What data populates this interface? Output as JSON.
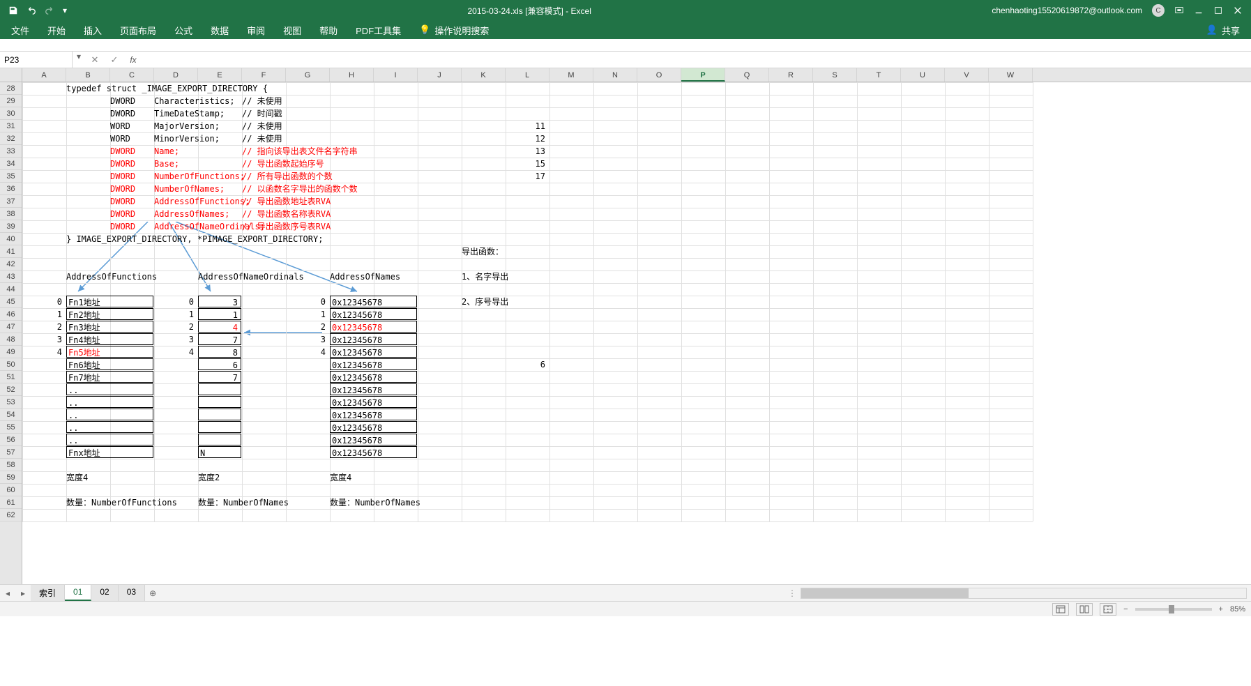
{
  "title_bar": {
    "doc_title": "2015-03-24.xls [兼容模式] - Excel",
    "user_email": "chenhaoting15520619872@outlook.com",
    "avatar_letter": "C"
  },
  "ribbon": {
    "tabs": [
      "文件",
      "开始",
      "插入",
      "页面布局",
      "公式",
      "数据",
      "审阅",
      "视图",
      "帮助",
      "PDF工具集"
    ],
    "tell_me": "操作说明搜索",
    "share": "共享"
  },
  "formula_bar": {
    "cell_ref": "P23",
    "fx_label": "fx",
    "formula_value": ""
  },
  "grid": {
    "columns": [
      "A",
      "B",
      "C",
      "D",
      "E",
      "F",
      "G",
      "H",
      "I",
      "J",
      "K",
      "L",
      "M",
      "N",
      "O",
      "P",
      "Q",
      "R",
      "S",
      "T",
      "U",
      "V",
      "W"
    ],
    "selected_column_index": 15,
    "row_start": 28,
    "row_end": 62,
    "rows": [
      {
        "r": 28,
        "cells": [
          {
            "c": 1,
            "t": "typedef struct _IMAGE_EXPORT_DIRECTORY {"
          }
        ]
      },
      {
        "r": 29,
        "cells": [
          {
            "c": 2,
            "t": "DWORD"
          },
          {
            "c": 3,
            "t": "Characteristics;"
          },
          {
            "c": 5,
            "t": "// 未使用"
          }
        ]
      },
      {
        "r": 30,
        "cells": [
          {
            "c": 2,
            "t": "DWORD"
          },
          {
            "c": 3,
            "t": "TimeDateStamp;"
          },
          {
            "c": 5,
            "t": "// 时间戳"
          }
        ]
      },
      {
        "r": 31,
        "cells": [
          {
            "c": 2,
            "t": "WORD"
          },
          {
            "c": 3,
            "t": "MajorVersion;"
          },
          {
            "c": 5,
            "t": "// 未使用"
          },
          {
            "c": 11,
            "t": "11",
            "ra": 1
          }
        ]
      },
      {
        "r": 32,
        "cells": [
          {
            "c": 2,
            "t": "WORD"
          },
          {
            "c": 3,
            "t": "MinorVersion;"
          },
          {
            "c": 5,
            "t": "// 未使用"
          },
          {
            "c": 11,
            "t": "12",
            "ra": 1
          }
        ]
      },
      {
        "r": 33,
        "cells": [
          {
            "c": 2,
            "t": "DWORD",
            "red": 1
          },
          {
            "c": 3,
            "t": "Name;",
            "red": 1
          },
          {
            "c": 5,
            "t": "// 指向该导出表文件名字符串",
            "red": 1
          },
          {
            "c": 11,
            "t": "13",
            "ra": 1
          }
        ]
      },
      {
        "r": 34,
        "cells": [
          {
            "c": 2,
            "t": "DWORD",
            "red": 1
          },
          {
            "c": 3,
            "t": "Base;",
            "red": 1
          },
          {
            "c": 5,
            "t": "// 导出函数起始序号",
            "red": 1
          },
          {
            "c": 11,
            "t": "15",
            "ra": 1
          }
        ]
      },
      {
        "r": 35,
        "cells": [
          {
            "c": 2,
            "t": "DWORD",
            "red": 1
          },
          {
            "c": 3,
            "t": "NumberOfFunctions;",
            "red": 1
          },
          {
            "c": 5,
            "t": "// 所有导出函数的个数",
            "red": 1
          },
          {
            "c": 11,
            "t": "17",
            "ra": 1
          }
        ]
      },
      {
        "r": 36,
        "cells": [
          {
            "c": 2,
            "t": "DWORD",
            "red": 1
          },
          {
            "c": 3,
            "t": "NumberOfNames;",
            "red": 1
          },
          {
            "c": 5,
            "t": "// 以函数名字导出的函数个数",
            "red": 1
          }
        ]
      },
      {
        "r": 37,
        "cells": [
          {
            "c": 2,
            "t": "DWORD",
            "red": 1
          },
          {
            "c": 3,
            "t": "AddressOfFunctions;",
            "red": 1
          },
          {
            "c": 5,
            "t": "   // 导出函数地址表RVA",
            "red": 1
          }
        ]
      },
      {
        "r": 38,
        "cells": [
          {
            "c": 2,
            "t": "DWORD",
            "red": 1
          },
          {
            "c": 3,
            "t": "AddressOfNames;",
            "red": 1
          },
          {
            "c": 5,
            "t": "   // 导出函数名称表RVA",
            "red": 1
          }
        ]
      },
      {
        "r": 39,
        "cells": [
          {
            "c": 2,
            "t": "DWORD",
            "red": 1
          },
          {
            "c": 3,
            "t": "AddressOfNameOrdinals;",
            "red": 1
          },
          {
            "c": 5,
            "t": "// 导出函数序号表RVA",
            "red": 1
          }
        ]
      },
      {
        "r": 40,
        "cells": [
          {
            "c": 1,
            "t": "} IMAGE_EXPORT_DIRECTORY, *PIMAGE_EXPORT_DIRECTORY;"
          }
        ]
      },
      {
        "r": 41,
        "cells": [
          {
            "c": 10,
            "t": "导出函数："
          }
        ]
      },
      {
        "r": 43,
        "cells": [
          {
            "c": 1,
            "t": "AddressOfFunctions"
          },
          {
            "c": 4,
            "t": "AddressOfNameOrdinals"
          },
          {
            "c": 7,
            "t": "AddressOfNames"
          },
          {
            "c": 10,
            "t": "1、名字导出"
          }
        ]
      },
      {
        "r": 45,
        "cells": [
          {
            "c": 0,
            "t": "0",
            "ra": 1
          },
          {
            "c": 1,
            "t": "Fn1地址",
            "box": 1,
            "w": 2
          },
          {
            "c": 3,
            "t": "0",
            "ra": 1
          },
          {
            "c": 4,
            "t": "3",
            "ra": 1,
            "box": 1
          },
          {
            "c": 6,
            "t": "0",
            "ra": 1
          },
          {
            "c": 7,
            "t": "0x12345678",
            "box": 1,
            "w": 2
          },
          {
            "c": 10,
            "t": "2、序号导出"
          }
        ]
      },
      {
        "r": 46,
        "cells": [
          {
            "c": 0,
            "t": "1",
            "ra": 1
          },
          {
            "c": 1,
            "t": "Fn2地址",
            "box": 1,
            "w": 2
          },
          {
            "c": 3,
            "t": "1",
            "ra": 1
          },
          {
            "c": 4,
            "t": "1",
            "ra": 1,
            "box": 1
          },
          {
            "c": 6,
            "t": "1",
            "ra": 1
          },
          {
            "c": 7,
            "t": "0x12345678",
            "box": 1,
            "w": 2
          }
        ]
      },
      {
        "r": 47,
        "cells": [
          {
            "c": 0,
            "t": "2",
            "ra": 1
          },
          {
            "c": 1,
            "t": "Fn3地址",
            "box": 1,
            "w": 2
          },
          {
            "c": 3,
            "t": "2",
            "ra": 1
          },
          {
            "c": 4,
            "t": "4",
            "ra": 1,
            "box": 1,
            "red": 1
          },
          {
            "c": 6,
            "t": "2",
            "ra": 1
          },
          {
            "c": 7,
            "t": "0x12345678",
            "box": 1,
            "w": 2,
            "red": 1
          }
        ]
      },
      {
        "r": 48,
        "cells": [
          {
            "c": 0,
            "t": "3",
            "ra": 1
          },
          {
            "c": 1,
            "t": "Fn4地址",
            "box": 1,
            "w": 2
          },
          {
            "c": 3,
            "t": "3",
            "ra": 1
          },
          {
            "c": 4,
            "t": "7",
            "ra": 1,
            "box": 1
          },
          {
            "c": 6,
            "t": "3",
            "ra": 1
          },
          {
            "c": 7,
            "t": "0x12345678",
            "box": 1,
            "w": 2
          }
        ]
      },
      {
        "r": 49,
        "cells": [
          {
            "c": 0,
            "t": "4",
            "ra": 1
          },
          {
            "c": 1,
            "t": "Fn5地址",
            "box": 1,
            "w": 2,
            "red": 1
          },
          {
            "c": 3,
            "t": "4",
            "ra": 1
          },
          {
            "c": 4,
            "t": "8",
            "ra": 1,
            "box": 1
          },
          {
            "c": 6,
            "t": "4",
            "ra": 1
          },
          {
            "c": 7,
            "t": "0x12345678",
            "box": 1,
            "w": 2
          }
        ]
      },
      {
        "r": 50,
        "cells": [
          {
            "c": 1,
            "t": "Fn6地址",
            "box": 1,
            "w": 2
          },
          {
            "c": 4,
            "t": "6",
            "ra": 1,
            "box": 1
          },
          {
            "c": 7,
            "t": "0x12345678",
            "box": 1,
            "w": 2
          },
          {
            "c": 11,
            "t": "6",
            "ra": 1
          }
        ]
      },
      {
        "r": 51,
        "cells": [
          {
            "c": 1,
            "t": "Fn7地址",
            "box": 1,
            "w": 2
          },
          {
            "c": 4,
            "t": "7",
            "ra": 1,
            "box": 1
          },
          {
            "c": 7,
            "t": "0x12345678",
            "box": 1,
            "w": 2
          }
        ]
      },
      {
        "r": 52,
        "cells": [
          {
            "c": 1,
            "t": "..",
            "box": 1,
            "w": 2
          },
          {
            "c": 4,
            "t": "",
            "box": 1
          },
          {
            "c": 7,
            "t": "0x12345678",
            "box": 1,
            "w": 2
          }
        ]
      },
      {
        "r": 53,
        "cells": [
          {
            "c": 1,
            "t": "..",
            "box": 1,
            "w": 2
          },
          {
            "c": 4,
            "t": "",
            "box": 1
          },
          {
            "c": 7,
            "t": "0x12345678",
            "box": 1,
            "w": 2
          }
        ]
      },
      {
        "r": 54,
        "cells": [
          {
            "c": 1,
            "t": "..",
            "box": 1,
            "w": 2
          },
          {
            "c": 4,
            "t": "",
            "box": 1
          },
          {
            "c": 7,
            "t": "0x12345678",
            "box": 1,
            "w": 2
          }
        ]
      },
      {
        "r": 55,
        "cells": [
          {
            "c": 1,
            "t": "..",
            "box": 1,
            "w": 2
          },
          {
            "c": 4,
            "t": "",
            "box": 1
          },
          {
            "c": 7,
            "t": "0x12345678",
            "box": 1,
            "w": 2
          }
        ]
      },
      {
        "r": 56,
        "cells": [
          {
            "c": 1,
            "t": "..",
            "box": 1,
            "w": 2
          },
          {
            "c": 4,
            "t": "",
            "box": 1
          },
          {
            "c": 7,
            "t": "0x12345678",
            "box": 1,
            "w": 2
          }
        ]
      },
      {
        "r": 57,
        "cells": [
          {
            "c": 1,
            "t": "Fnx地址",
            "box": 1,
            "w": 2
          },
          {
            "c": 4,
            "t": "N",
            "box": 1
          },
          {
            "c": 7,
            "t": "0x12345678",
            "box": 1,
            "w": 2
          }
        ]
      },
      {
        "r": 59,
        "cells": [
          {
            "c": 1,
            "t": "宽度4"
          },
          {
            "c": 4,
            "t": "宽度2"
          },
          {
            "c": 7,
            "t": "宽度4"
          }
        ]
      },
      {
        "r": 61,
        "cells": [
          {
            "c": 1,
            "t": "数量：NumberOfFunctions"
          },
          {
            "c": 4,
            "t": "数量：NumberOfNames"
          },
          {
            "c": 7,
            "t": "数量：NumberOfNames"
          }
        ]
      }
    ]
  },
  "sheet_tabs": {
    "tabs": [
      "索引",
      "01",
      "02",
      "03"
    ],
    "active_index": 1
  },
  "status_bar": {
    "zoom_percent": "85%"
  }
}
